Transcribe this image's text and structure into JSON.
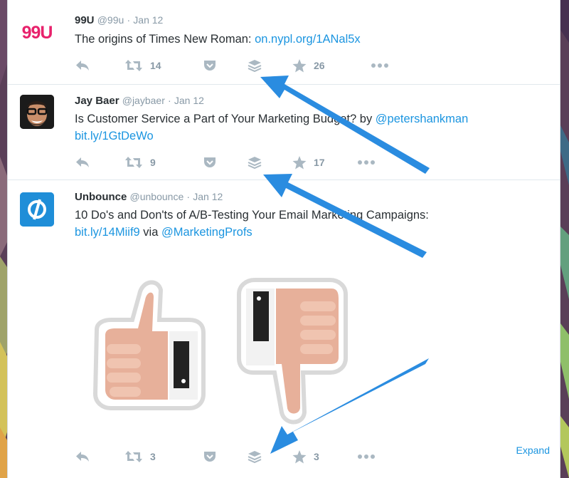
{
  "colors": {
    "accent": "#1b95e0",
    "arrow": "#2a8ce0",
    "muted": "#8899a6",
    "text": "#292f33"
  },
  "tweets": [
    {
      "name": "99U",
      "handle": "@99u",
      "sep": "·",
      "date": "Jan 12",
      "text": "The origins of Times New Roman: ",
      "link": "on.nypl.org/1ANal5x",
      "avatar_logo": "99U",
      "retweets": "14",
      "favorites": "26"
    },
    {
      "name": "Jay Baer",
      "handle": "@jaybaer",
      "sep": "·",
      "date": "Jan 12",
      "text": "Is Customer Service a Part of Your Marketing Budget? by ",
      "mention": "@petershankman",
      "link": "bit.ly/1GtDeWo",
      "retweets": "9",
      "favorites": "17"
    },
    {
      "name": "Unbounce",
      "handle": "@unbounce",
      "sep": "·",
      "date": "Jan 12",
      "text": "10 Do's and Don'ts of A/B-Testing Your Email Marketing Campaigns:",
      "link": "bit.ly/14Miif9",
      "via": " via ",
      "mention": "@MarketingProfs",
      "retweets": "3",
      "favorites": "3",
      "expand": "Expand"
    }
  ],
  "icons": {
    "reply": "reply-icon",
    "retweet": "retweet-icon",
    "pocket": "pocket-icon",
    "buffer": "buffer-icon",
    "favorite": "star-icon",
    "more": "more-icon"
  }
}
